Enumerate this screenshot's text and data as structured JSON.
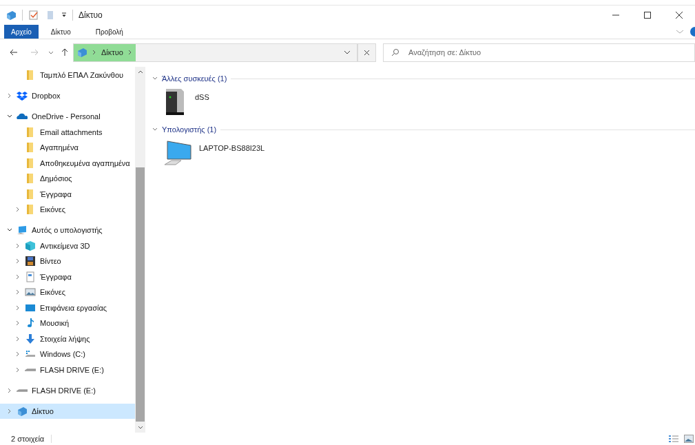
{
  "window": {
    "title": "Δίκτυο"
  },
  "ribbon_tabs": [
    {
      "label": "Αρχείο",
      "selected": true
    },
    {
      "label": "Δίκτυο",
      "selected": false
    },
    {
      "label": "Προβολή",
      "selected": false
    }
  ],
  "address": {
    "crumbs": [
      "Δίκτυο"
    ]
  },
  "search": {
    "placeholder": "Αναζήτηση σε: Δίκτυο"
  },
  "nav_continued": [
    {
      "label": "Ταμπλό ΕΠΑΛ Ζακύνθου",
      "kind": "folder",
      "selected": false
    }
  ],
  "nav": [
    {
      "label": "Dropbox",
      "kind": "dropbox",
      "expanded": false,
      "selected": false
    },
    {
      "label": "OneDrive - Personal",
      "kind": "cloud",
      "expanded": true,
      "selected": false,
      "children": [
        {
          "label": "Email attachments",
          "kind": "folder",
          "selected": false
        },
        {
          "label": "Αγαπημένα",
          "kind": "folder",
          "selected": false
        },
        {
          "label": "Αποθηκευμένα αγαπημένα",
          "kind": "folder",
          "selected": false
        },
        {
          "label": "Δημόσιος",
          "kind": "folder",
          "selected": false
        },
        {
          "label": "Έγγραφα",
          "kind": "folder",
          "selected": false
        },
        {
          "label": "Εικόνες",
          "kind": "folder",
          "expanded": false,
          "selected": false
        }
      ]
    },
    {
      "label": "Αυτός ο υπολογιστής",
      "kind": "pc",
      "expanded": true,
      "selected": false,
      "children": [
        {
          "label": "Αντικείμενα 3D",
          "kind": "cube",
          "expanded": false,
          "selected": false
        },
        {
          "label": "Βίντεο",
          "kind": "film",
          "expanded": false,
          "selected": false
        },
        {
          "label": "Έγγραφα",
          "kind": "doc",
          "expanded": false,
          "selected": false
        },
        {
          "label": "Εικόνες",
          "kind": "image",
          "expanded": false,
          "selected": false
        },
        {
          "label": "Επιφάνεια εργασίας",
          "kind": "desktop",
          "expanded": false,
          "selected": false
        },
        {
          "label": "Μουσική",
          "kind": "music",
          "expanded": false,
          "selected": false
        },
        {
          "label": "Στοιχεία λήψης",
          "kind": "download",
          "expanded": false,
          "selected": false
        },
        {
          "label": "Windows (C:)",
          "kind": "windrive",
          "expanded": false,
          "selected": false
        },
        {
          "label": "FLASH DRIVE (E:)",
          "kind": "drive",
          "expanded": false,
          "selected": false
        }
      ]
    },
    {
      "label": "FLASH DRIVE (E:)",
      "kind": "drive",
      "expanded": false,
      "selected": false
    },
    {
      "label": "Δίκτυο",
      "kind": "network",
      "expanded": false,
      "selected": true
    }
  ],
  "groups": [
    {
      "title": "Άλλες συσκευές (1)",
      "expanded": true,
      "items": [
        {
          "label": "dSS",
          "kind": "device"
        }
      ]
    },
    {
      "title": "Υπολογιστής (1)",
      "expanded": true,
      "items": [
        {
          "label": "LAPTOP-BS88I23L",
          "kind": "computer"
        }
      ]
    }
  ],
  "status_bar": {
    "count": "2 στοιχεία"
  }
}
